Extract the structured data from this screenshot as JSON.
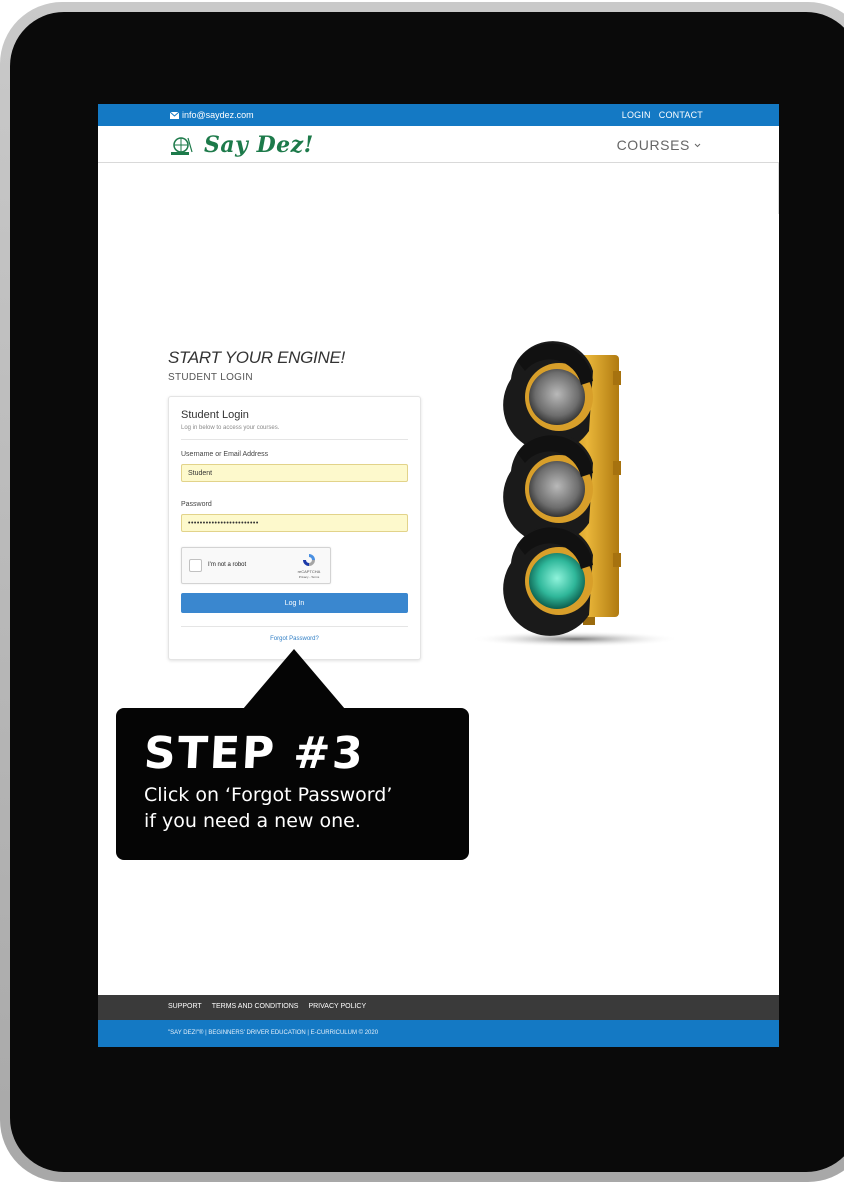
{
  "topbar": {
    "email": "info@saydez.com",
    "login_label": "LOGIN",
    "contact_label": "CONTACT"
  },
  "header": {
    "logo_text": "Say Dez!",
    "courses_label": "COURSES"
  },
  "hero": {
    "headline": "START YOUR ENGINE!",
    "subheadline": "STUDENT LOGIN"
  },
  "login_card": {
    "title": "Student Login",
    "subtitle": "Log in below to access your courses.",
    "username_label": "Username or Email Address",
    "username_value": "Student",
    "password_label": "Password",
    "password_value": "••••••••••••••••••••••••",
    "captcha_label": "I'm not a robot",
    "captcha_brand": "reCAPTCHA",
    "captcha_terms": "Privacy - Terms",
    "login_button": "Log In",
    "forgot_link": "Forgot Password?"
  },
  "callout": {
    "heading": "STEP #3",
    "line1": "Click on ‘Forgot Password’",
    "line2": "if you need a new one."
  },
  "footer": {
    "links": [
      "SUPPORT",
      "TERMS AND CONDITIONS",
      "PRIVACY POLICY"
    ],
    "copyright": "\"SAY DEZ!\"® | BEGINNERS' DRIVER EDUCATION | E-CURRICULUM © 2020"
  },
  "colors": {
    "brand_blue": "#1479c4",
    "logo_green": "#1d7a4a",
    "button_blue": "#3a87cf",
    "autofill_yellow": "#fdf9cc",
    "footer_dark": "#3a3a3a"
  },
  "icons": [
    "envelope-icon",
    "chevron-down-icon",
    "recaptcha-icon",
    "driver-logo-icon"
  ]
}
